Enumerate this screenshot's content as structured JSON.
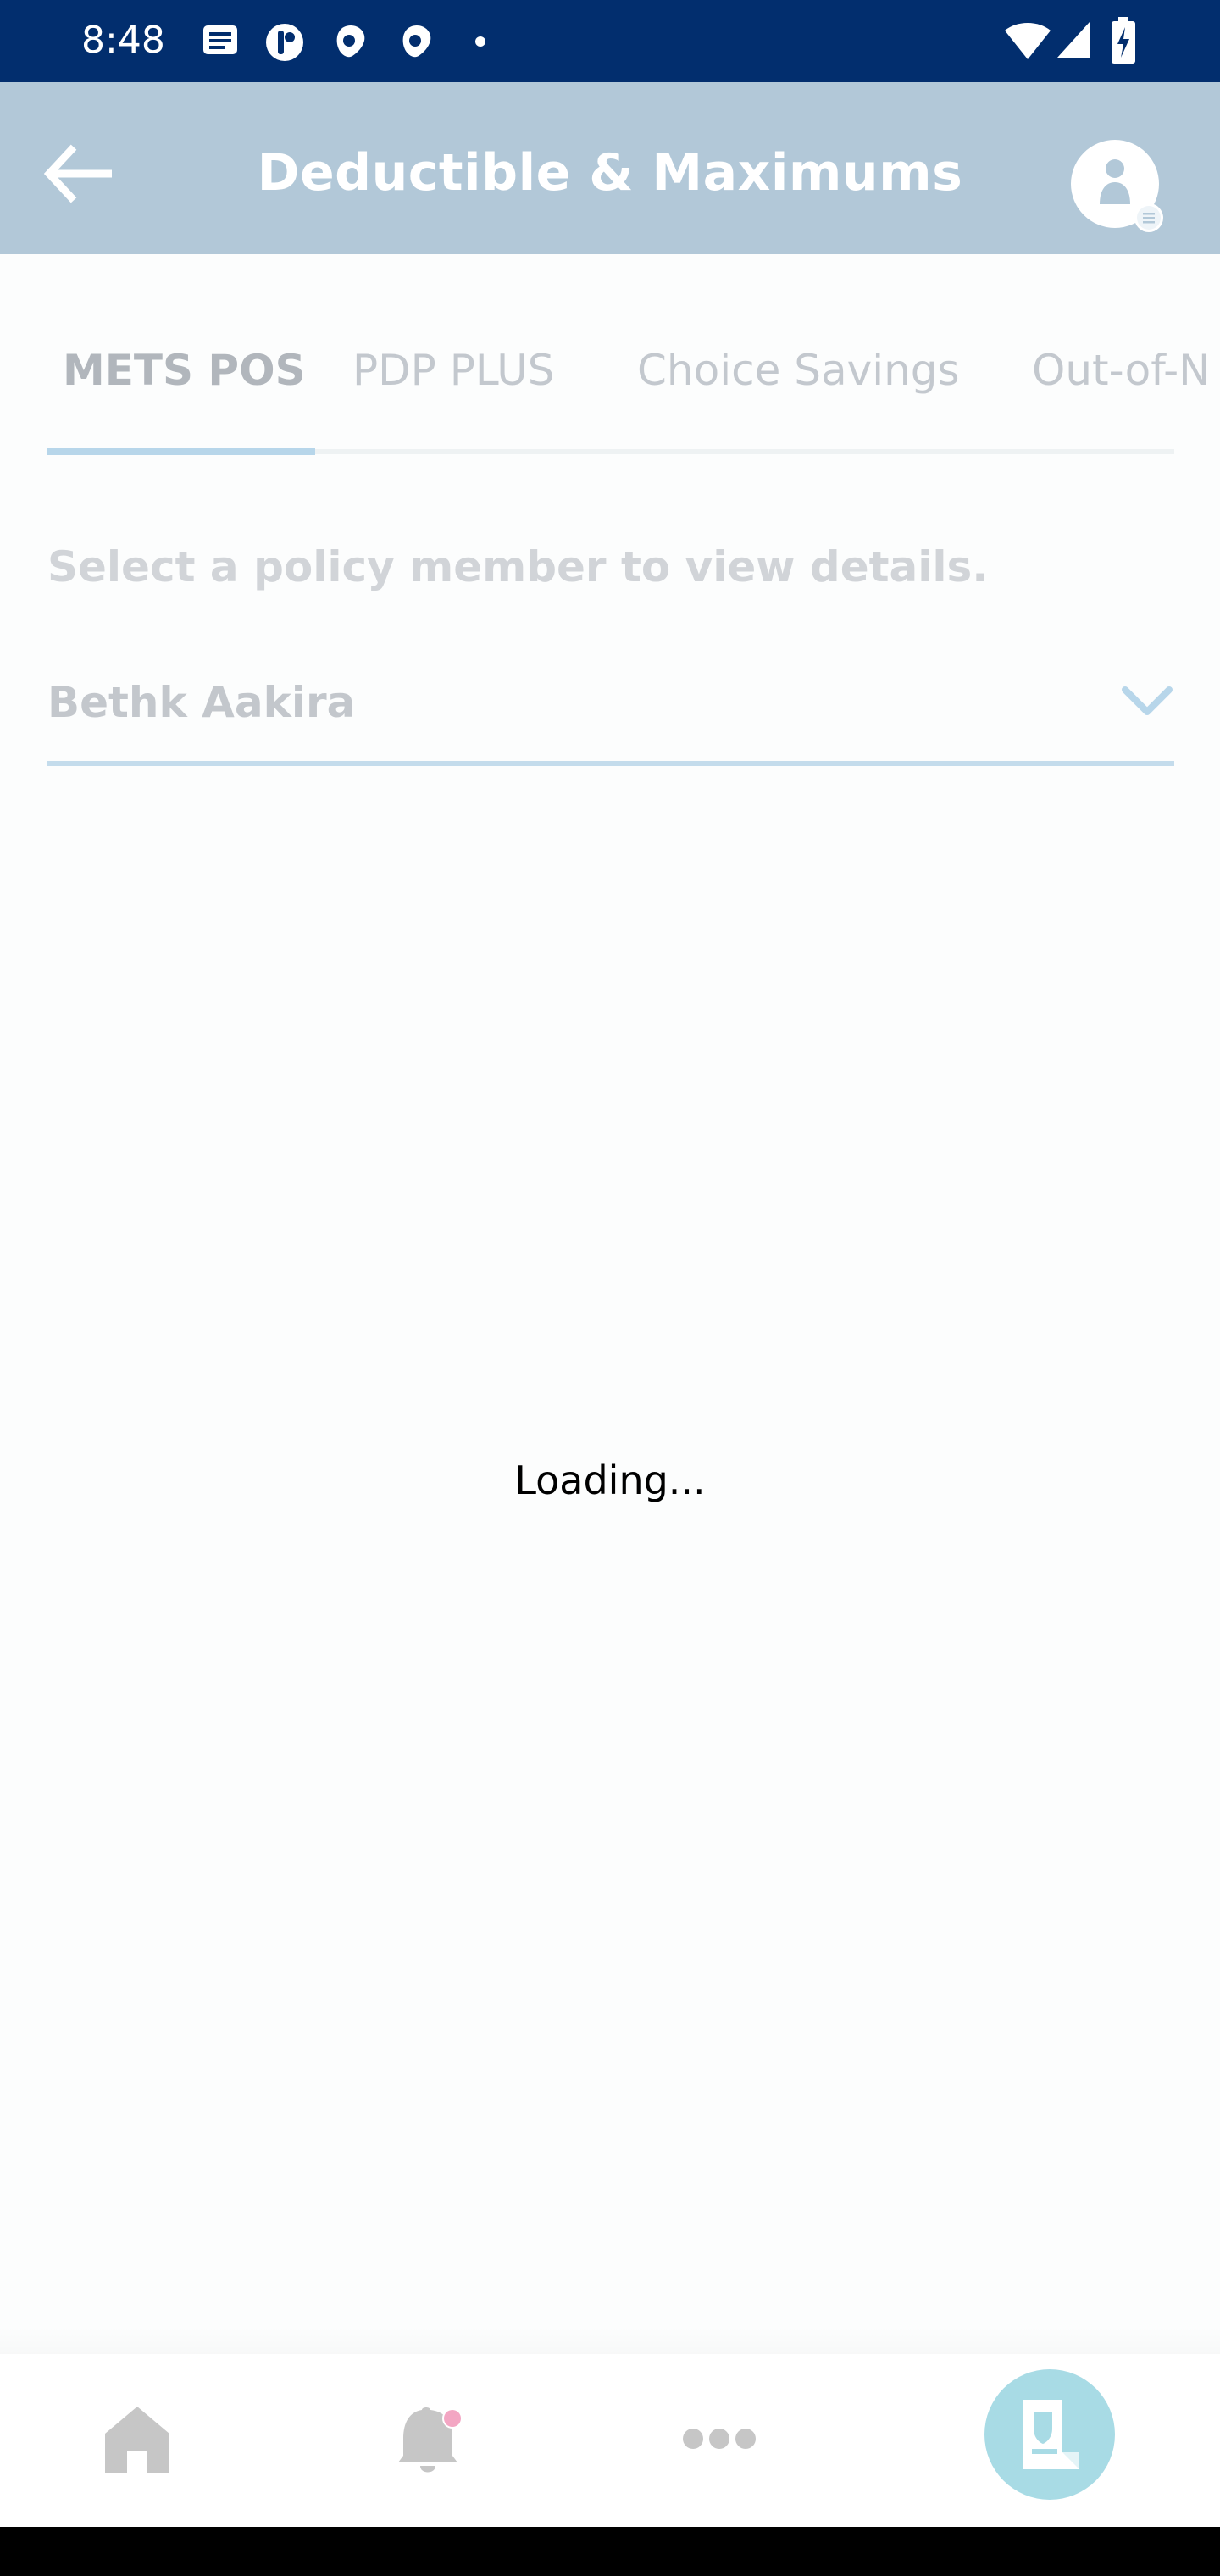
{
  "status_bar": {
    "time": "8:48",
    "left_icons": [
      "message-icon",
      "app-icon",
      "app-icon",
      "app-icon",
      "dot-icon"
    ],
    "right_icons": [
      "wifi-icon",
      "signal-icon",
      "battery-icon"
    ]
  },
  "app_bar": {
    "title": "Deductible & Maximums",
    "back_icon": "back-arrow-icon",
    "profile_icon": "profile-icon"
  },
  "tabs": [
    {
      "label": "METS POS",
      "active": true
    },
    {
      "label": "PDP PLUS",
      "active": false
    },
    {
      "label": "Choice Savings",
      "active": false
    },
    {
      "label": "Out-of-N",
      "active": false
    }
  ],
  "member_selector": {
    "prompt": "Select a policy member to view details.",
    "selected": "Bethk Aakira"
  },
  "loading_text": "Loading...",
  "bottom_nav": {
    "items": [
      "home-icon",
      "bell-icon",
      "more-icon",
      "id-card-icon"
    ],
    "active_color": "#a8dbe5",
    "notification_dot_color": "#f3a6c3"
  },
  "colors": {
    "status_bar": "#022e6e",
    "app_bar": "#b2c8d8",
    "accent": "#b7d6ea"
  }
}
